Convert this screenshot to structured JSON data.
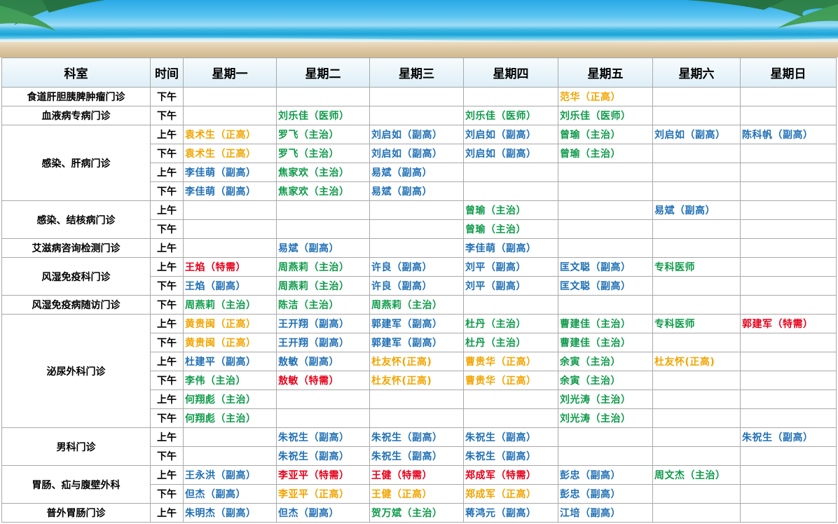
{
  "header": {
    "columns": [
      "科室",
      "时间",
      "星期一",
      "星期二",
      "星期三",
      "星期四",
      "星期五",
      "星期六",
      "星期日"
    ]
  },
  "colors": {
    "blue": "#1f6fb4",
    "green": "#0f9a4a",
    "orange": "#f2a400",
    "red": "#e6001a"
  },
  "rows": [
    {
      "dept": "食道肝胆胰脾肿瘤门诊",
      "span": 1,
      "time": "下午",
      "cells": [
        null,
        null,
        null,
        null,
        {
          "t": "范华（正高）",
          "c": "orange"
        },
        null,
        null
      ]
    },
    {
      "dept": "血液病专病门诊",
      "span": 1,
      "time": "下午",
      "cells": [
        null,
        {
          "t": "刘乐佳（医师）",
          "c": "green"
        },
        null,
        {
          "t": "刘乐佳（医师）",
          "c": "green"
        },
        {
          "t": "刘乐佳（医师）",
          "c": "green"
        },
        null,
        null
      ]
    },
    {
      "dept": "感染、肝病门诊",
      "span": 4,
      "time": "上午",
      "cells": [
        {
          "t": "袁术生（正高）",
          "c": "orange"
        },
        {
          "t": "罗飞（主治）",
          "c": "green"
        },
        {
          "t": "刘启如（副高）",
          "c": "blue"
        },
        {
          "t": "刘启如（副高）",
          "c": "blue"
        },
        {
          "t": "曾瑜（主治）",
          "c": "green"
        },
        {
          "t": "刘启如（副高）",
          "c": "blue"
        },
        {
          "t": "陈科帆（副高）",
          "c": "blue"
        }
      ]
    },
    {
      "time": "下午",
      "cells": [
        {
          "t": "袁术生（正高）",
          "c": "orange"
        },
        {
          "t": "罗飞（主治）",
          "c": "green"
        },
        {
          "t": "刘启如（副高）",
          "c": "blue"
        },
        {
          "t": "刘启如（副高）",
          "c": "blue"
        },
        {
          "t": "曾瑜（主治）",
          "c": "green"
        },
        null,
        null
      ]
    },
    {
      "time": "上午",
      "cells": [
        {
          "t": "李佳萌（副高）",
          "c": "blue"
        },
        {
          "t": "焦家欢（主治）",
          "c": "green"
        },
        {
          "t": "易斌（副高）",
          "c": "blue"
        },
        null,
        null,
        null,
        null
      ]
    },
    {
      "time": "下午",
      "cells": [
        {
          "t": "李佳萌（副高）",
          "c": "blue"
        },
        {
          "t": "焦家欢（主治）",
          "c": "green"
        },
        {
          "t": "易斌（副高）",
          "c": "blue"
        },
        null,
        null,
        null,
        null
      ]
    },
    {
      "dept": "感染、结核病门诊",
      "span": 2,
      "time": "上午",
      "cells": [
        null,
        null,
        null,
        {
          "t": "曾瑜（主治）",
          "c": "green"
        },
        null,
        {
          "t": "易斌（副高）",
          "c": "blue"
        },
        null
      ]
    },
    {
      "time": "下午",
      "cells": [
        null,
        null,
        null,
        {
          "t": "曾瑜（主治）",
          "c": "green"
        },
        null,
        null,
        null
      ]
    },
    {
      "dept": "艾滋病咨询检测门诊",
      "span": 1,
      "time": "上午",
      "cells": [
        null,
        {
          "t": "易斌（副高）",
          "c": "blue"
        },
        null,
        {
          "t": "李佳萌（副高）",
          "c": "blue"
        },
        null,
        null,
        null
      ]
    },
    {
      "dept": "风湿免疫科门诊",
      "span": 2,
      "time": "上午",
      "cells": [
        {
          "t": "王焰（特需）",
          "c": "red"
        },
        {
          "t": "周燕莉（主治）",
          "c": "green"
        },
        {
          "t": "许良（副高）",
          "c": "blue"
        },
        {
          "t": "刘平（副高）",
          "c": "blue"
        },
        {
          "t": "匡文聪（副高）",
          "c": "blue"
        },
        {
          "t": "专科医师",
          "c": "green"
        },
        null
      ]
    },
    {
      "time": "下午",
      "cells": [
        {
          "t": "王焰（副高）",
          "c": "blue"
        },
        {
          "t": "周燕莉（主治）",
          "c": "green"
        },
        {
          "t": "许良（副高）",
          "c": "blue"
        },
        {
          "t": "刘平（副高）",
          "c": "blue"
        },
        {
          "t": "匡文聪（副高）",
          "c": "blue"
        },
        null,
        null
      ]
    },
    {
      "dept": "风湿免疫病随访门诊",
      "span": 1,
      "time": "下午",
      "cells": [
        {
          "t": "周燕莉（主治）",
          "c": "green"
        },
        {
          "t": "陈洁（主治）",
          "c": "green"
        },
        {
          "t": "周燕莉（主治）",
          "c": "green"
        },
        null,
        null,
        null,
        null
      ]
    },
    {
      "dept": "泌尿外科门诊",
      "span": 6,
      "time": "上午",
      "cells": [
        {
          "t": "黄贵闽（正高）",
          "c": "orange"
        },
        {
          "t": "王开翔（副高）",
          "c": "blue"
        },
        {
          "t": "郭建军（副高）",
          "c": "blue"
        },
        {
          "t": "杜丹（主治）",
          "c": "green"
        },
        {
          "t": "曹建佳（主治）",
          "c": "green"
        },
        {
          "t": "专科医师",
          "c": "green"
        },
        {
          "t": "郭建军（特需）",
          "c": "red"
        }
      ]
    },
    {
      "time": "下午",
      "cells": [
        {
          "t": "黄贵闽（正高）",
          "c": "orange"
        },
        {
          "t": "王开翔（副高）",
          "c": "blue"
        },
        {
          "t": "郭建军（副高）",
          "c": "blue"
        },
        {
          "t": "杜丹（主治）",
          "c": "green"
        },
        {
          "t": "曹建佳（主治）",
          "c": "green"
        },
        null,
        null
      ]
    },
    {
      "time": "上午",
      "cells": [
        {
          "t": "杜建平（副高）",
          "c": "blue"
        },
        {
          "t": "敖敏（副高）",
          "c": "blue"
        },
        {
          "t": "杜友怀(正高)",
          "c": "orange"
        },
        {
          "t": "曹贵华（正高）",
          "c": "orange"
        },
        {
          "t": "余寅（主治）",
          "c": "green"
        },
        {
          "t": "杜友怀(正高)",
          "c": "orange"
        },
        null
      ]
    },
    {
      "time": "下午",
      "cells": [
        {
          "t": "李伟（主治）",
          "c": "green"
        },
        {
          "t": "敖敏（特需）",
          "c": "red"
        },
        {
          "t": "杜友怀(正高)",
          "c": "orange"
        },
        {
          "t": "曹贵华（正高）",
          "c": "orange"
        },
        {
          "t": "余寅（主治）",
          "c": "green"
        },
        null,
        null
      ]
    },
    {
      "time": "上午",
      "cells": [
        {
          "t": "何翔彪（主治）",
          "c": "green"
        },
        null,
        null,
        null,
        {
          "t": "刘光涛（主治）",
          "c": "green"
        },
        null,
        null
      ]
    },
    {
      "time": "下午",
      "cells": [
        {
          "t": "何翔彪（主治）",
          "c": "green"
        },
        null,
        null,
        null,
        {
          "t": "刘光涛（主治）",
          "c": "green"
        },
        null,
        null
      ]
    },
    {
      "dept": "男科门诊",
      "span": 2,
      "time": "上午",
      "cells": [
        null,
        {
          "t": "朱祝生（副高）",
          "c": "blue"
        },
        {
          "t": "朱祝生（副高）",
          "c": "blue"
        },
        {
          "t": "朱祝生（副高）",
          "c": "blue"
        },
        null,
        null,
        {
          "t": "朱祝生（副高）",
          "c": "blue"
        }
      ]
    },
    {
      "time": "下午",
      "cells": [
        null,
        {
          "t": "朱祝生（副高）",
          "c": "blue"
        },
        {
          "t": "朱祝生（副高）",
          "c": "blue"
        },
        {
          "t": "朱祝生（副高）",
          "c": "blue"
        },
        null,
        null,
        null
      ]
    },
    {
      "dept": "胃肠、疝与腹壁外科",
      "span": 2,
      "time": "上午",
      "cells": [
        {
          "t": "王永洪（副高）",
          "c": "blue"
        },
        {
          "t": "李亚平（特需）",
          "c": "red"
        },
        {
          "t": "王健（特需）",
          "c": "red"
        },
        {
          "t": "郑成军（特需）",
          "c": "red"
        },
        {
          "t": "彭忠（副高）",
          "c": "blue"
        },
        {
          "t": "周文杰（主治）",
          "c": "green"
        },
        null
      ]
    },
    {
      "time": "下午",
      "cells": [
        {
          "t": "但杰（副高）",
          "c": "blue"
        },
        {
          "t": "李亚平（正高）",
          "c": "orange"
        },
        {
          "t": "王健（正高）",
          "c": "orange"
        },
        {
          "t": "郑成军（正高）",
          "c": "orange"
        },
        {
          "t": "彭忠（副高）",
          "c": "blue"
        },
        null,
        null
      ]
    },
    {
      "dept": "普外胃肠门诊",
      "span": 1,
      "time": "上午",
      "cells": [
        {
          "t": "朱明杰（副高）",
          "c": "blue"
        },
        {
          "t": "但杰（副高）",
          "c": "blue"
        },
        {
          "t": "贺万斌（主治）",
          "c": "green"
        },
        {
          "t": "蒋鸿元（副高）",
          "c": "blue"
        },
        {
          "t": "江培（副高）",
          "c": "blue"
        },
        null,
        null
      ]
    }
  ]
}
